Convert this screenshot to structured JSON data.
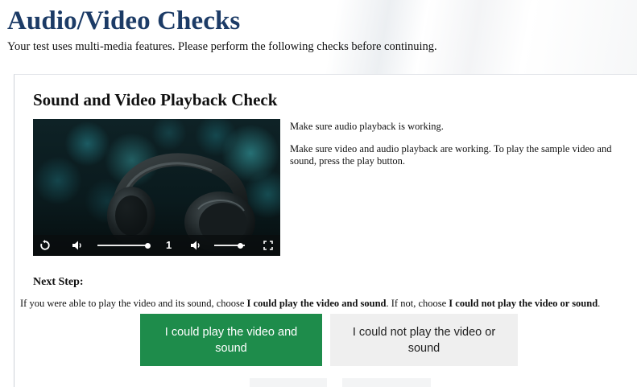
{
  "page": {
    "title": "Audio/Video Checks",
    "subtitle": "Your test uses multi-media features. Please perform the following checks before continuing."
  },
  "section": {
    "title": "Sound and Video Playback Check",
    "instructions": [
      "Make sure audio playback is working.",
      "Make sure video and audio playback are working. To play the sample video and sound, press the play button."
    ]
  },
  "video_player": {
    "speed_label": "1",
    "progress_fraction": 1.0,
    "volume_fraction": 0.85,
    "controls": [
      "replay-icon",
      "volume-icon",
      "volume-icon",
      "fullscreen-icon"
    ]
  },
  "next_step": {
    "title": "Next Step:",
    "line": {
      "part1": "If you were able to play the video and its sound, choose ",
      "bold1": "I could play the video and sound",
      "part2": ". If not, choose ",
      "bold2": "I could not play the video or sound",
      "part3": "."
    },
    "buttons": {
      "yes_label": "I could play the video and sound",
      "no_label": "I could not play the video or sound"
    }
  },
  "colors": {
    "title": "#1c3b66",
    "yes_button": "#1e8c4b",
    "no_button": "#efefef"
  }
}
